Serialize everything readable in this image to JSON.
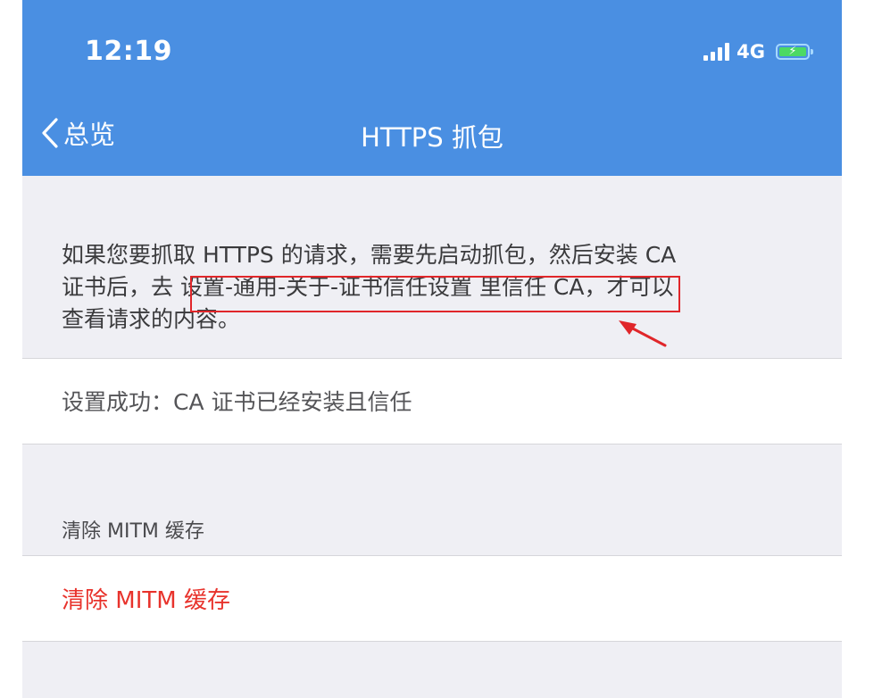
{
  "status_bar": {
    "time": "12:19",
    "network": "4G",
    "battery_charging": true,
    "signal_bars": 4
  },
  "nav": {
    "back_label": "总览",
    "title": "HTTPS 抓包",
    "bg_color": "#4a8fe2"
  },
  "description": {
    "line1": "如果您要抓取 HTTPS 的请求，需要先启动抓包，然后安装 CA",
    "line2_prefix": "证书后，去 ",
    "line2_highlight": "设置-通用-关于-证书信任设置 里信任 CA",
    "line2_suffix": "，才可以",
    "line3": "查看请求的内容。"
  },
  "status_row": {
    "text": "设置成功：CA 证书已经安装且信任"
  },
  "mitm_section": {
    "header": "清除 MITM 缓存",
    "action_label": "清除 MITM 缓存",
    "action_color": "#e8332c"
  },
  "annotation": {
    "box_color": "#e0262a"
  }
}
